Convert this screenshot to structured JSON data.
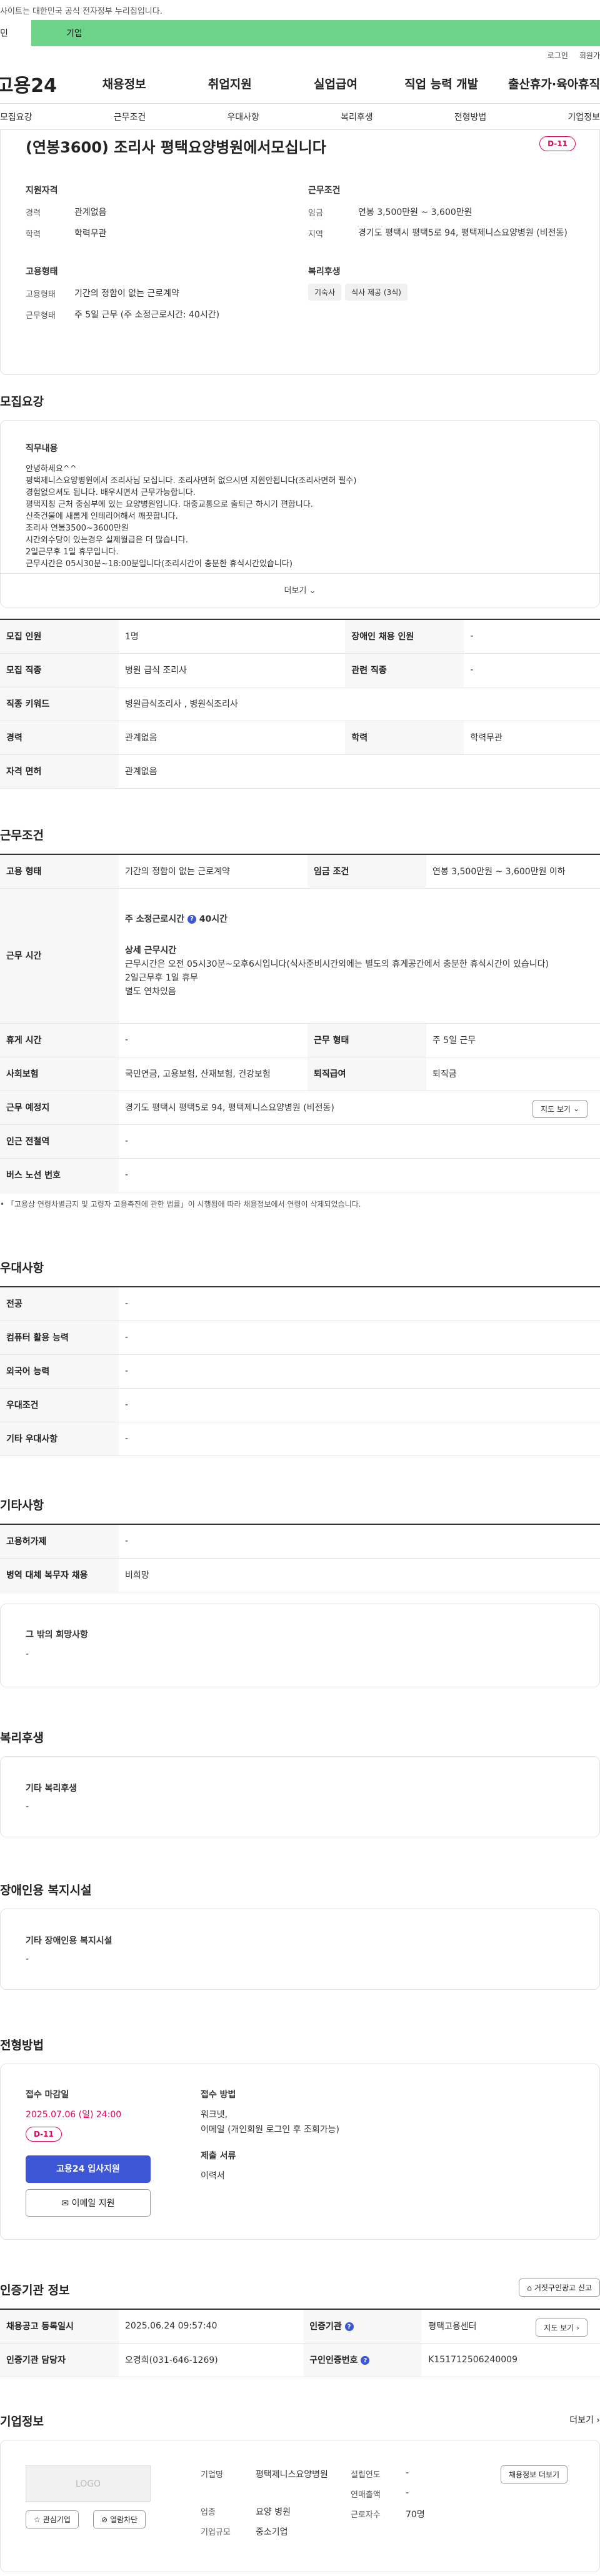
{
  "notice": {
    "text": "사이트는 대한민국 공식 전자정부 누리집입니다."
  },
  "top_tabs": {
    "a": "민",
    "b": "기업"
  },
  "util": {
    "login": "로그인",
    "join": "회원가"
  },
  "gnb": {
    "logo": "고용24",
    "items": [
      "채용정보",
      "취업지원",
      "실업급여",
      "직업 능력 개발",
      "출산휴가·육아휴직"
    ]
  },
  "anchors": [
    "모집요강",
    "근무조건",
    "우대사항",
    "복리후생",
    "전형방법",
    "기업정보"
  ],
  "job": {
    "title": "(연봉3600) 조리사 평택요양병원에서모십니다",
    "dday": "D-11",
    "qual": {
      "heading": "지원자격",
      "career_k": "경력",
      "career_v": "관계없음",
      "edu_k": "학력",
      "edu_v": "학력무관"
    },
    "cond": {
      "heading": "근무조건",
      "wage_k": "임금",
      "wage_v": "연봉 3,500만원 ~ 3,600만원",
      "loc_k": "지역",
      "loc_v": "경기도 평택시 평택5로 94, 평택제니스요양병원 (비전동)"
    },
    "emp": {
      "heading": "고용형태",
      "type_k": "고용형태",
      "type_v": "기간의 정함이 없는 근로계약",
      "work_k": "근무형태",
      "work_v": "주 5일 근무 (주 소정근로시간: 40시간)"
    },
    "welfare": {
      "heading": "복리후생",
      "chips": [
        "기숙사",
        "식사 제공 (3식)"
      ]
    }
  },
  "recruit": {
    "heading": "모집요강",
    "duty_h": "직무내용",
    "duty_lines": [
      "안녕하세요^^",
      "평택제니스요양병원에서 조리사님 모십니다. 조리사면허 없으시면 지원안됩니다(조리사면허 필수)",
      "경험없으셔도 됩니다. 배우시면서 근무가능합니다.",
      "평택지칭 근처 중심부에 있는 요양병원입니다. 대중교통으로 출퇴근 하시기 편합니다.",
      "신축건물에 새롭게 인테리어해서 깨끗합니다.",
      "조리사 연봉3500~3600만원",
      "시간외수당이 있는경우 실제월급은 더 많습니다.",
      "2일근무후 1일 휴무입니다.",
      "근무시간은 05시30분~18:00분입니다(조리시간이 충분한 휴식시간있습니다)"
    ],
    "more": "더보기",
    "rows": [
      [
        "모집 인원",
        "1명",
        "장애인 채용 인원",
        "-"
      ],
      [
        "모집 직종",
        "병원 급식 조리사",
        "관련 직종",
        "-"
      ],
      [
        "직종 키워드",
        "병원급식조리사 , 병원식조리사",
        "",
        ""
      ],
      [
        "경력",
        "관계없음",
        "학력",
        "학력무관"
      ],
      [
        "자격 면허",
        "관계없음",
        "",
        ""
      ]
    ]
  },
  "workcond": {
    "heading": "근무조건",
    "r1": [
      "고용 형태",
      "기간의 정함이 없는 근로계약",
      "임금 조건",
      "연봉 3,500만원 ~ 3,600만원 이하"
    ],
    "time_h": "근무 시간",
    "time_total": "주 소정근로시간",
    "time_hours": "40시간",
    "time_detail_h": "상세 근무시간",
    "time_detail": [
      "근무시간은 오전 05시30분~오후6시입니다(식사준비시간외에는 별도의 휴게공간에서 충분한 휴식시간이 있습니다)",
      "2일근무후 1일 휴무",
      "별도 연차있음"
    ],
    "r3": [
      "휴게 시간",
      "-",
      "근무 형태",
      "주 5일 근무"
    ],
    "r4": [
      "사회보험",
      "국민연금, 고용보험, 산재보험, 건강보험",
      "퇴직급여",
      "퇴직금"
    ],
    "r5": [
      "근무 예정지",
      "경기도 평택시 평택5로 94, 평택제니스요양병원 (비전동)"
    ],
    "map": "지도 보기",
    "r6": [
      "인근 전철역",
      "-"
    ],
    "r7": [
      "버스 노선 번호",
      "-"
    ],
    "note": "「고용상 연령차별금지 및 고령자 고용촉진에 관한 법률」이 시행됨에 따라 채용정보에서 연령이 삭제되었습니다."
  },
  "pref": {
    "heading": "우대사항",
    "rows": [
      [
        "전공",
        "-"
      ],
      [
        "컴퓨터 활용 능력",
        "-"
      ],
      [
        "외국어 능력",
        "-"
      ],
      [
        "우대조건",
        "-"
      ],
      [
        "기타 우대사항",
        "-"
      ]
    ]
  },
  "other": {
    "heading": "기타사항",
    "rows": [
      [
        "고용허가제",
        "-"
      ],
      [
        "병역 대체 복무자 채용",
        "비희망"
      ]
    ],
    "hope_h": "그 밖의 희망사항",
    "hope_v": "-"
  },
  "benefit": {
    "heading": "복리후생",
    "box_h": "기타 복리후생",
    "box_v": "-"
  },
  "disab": {
    "heading": "장애인용 복지시설",
    "box_h": "기타 장애인용 복지시설",
    "box_v": "-"
  },
  "screen": {
    "heading": "전형방법",
    "deadline_h": "접수 마감일",
    "deadline": "2025.07.06 (일) 24:00",
    "dday": "D-11",
    "apply": "고용24 입사지원",
    "email": "이메일 지원",
    "method_h": "접수 방법",
    "method_v1": "워크넷,",
    "method_v2": "이메일 (개인회원 로그인 후 조회가능)",
    "docs_h": "제출 서류",
    "docs_v": "이력서"
  },
  "agency": {
    "heading": "인증기관 정보",
    "report": "거짓구인광고 신고",
    "r1": [
      "채용공고 등록일시",
      "2025.06.24 09:57:40",
      "인증기관",
      "평택고용센터"
    ],
    "r2": [
      "인증기관 담당자",
      "오경희(031-646-1269)",
      "구인인증번호",
      "K151712506240009"
    ],
    "map": "지도 보기"
  },
  "company": {
    "heading": "기업정보",
    "more": "더보기",
    "logo": "LOGO",
    "fav": "관심기업",
    "block": "열람차단",
    "name_k": "기업명",
    "name_v": "평택제니스요양병원",
    "ind_k": "업종",
    "ind_v": "요양 병원",
    "scale_k": "기업규모",
    "scale_v": "중소기업",
    "est_k": "설립연도",
    "est_v": "-",
    "sales_k": "연매출액",
    "sales_v": "-",
    "emp_k": "근로자수",
    "emp_v": "70명",
    "list": "채용정보 더보기"
  }
}
